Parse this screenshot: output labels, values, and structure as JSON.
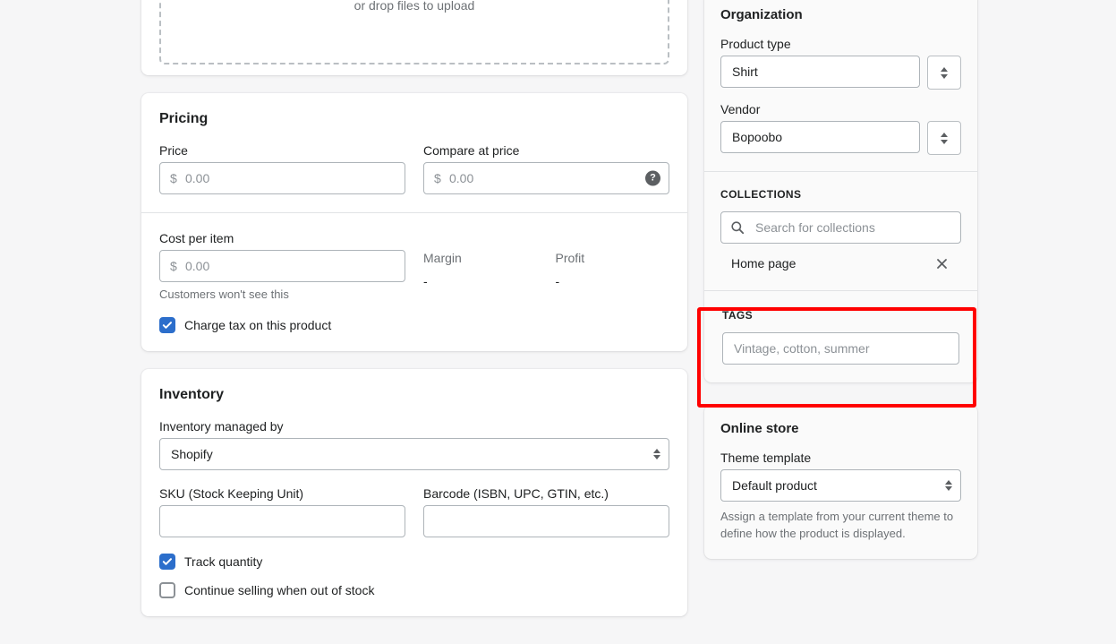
{
  "media": {
    "dropzone_text": "or drop files to upload"
  },
  "pricing": {
    "title": "Pricing",
    "price": {
      "label": "Price",
      "currency_symbol": "$",
      "value": "",
      "placeholder": "0.00"
    },
    "compare_at_price": {
      "label": "Compare at price",
      "currency_symbol": "$",
      "value": "",
      "placeholder": "0.00",
      "help_icon_glyph": "?"
    },
    "cost_per_item": {
      "label": "Cost per item",
      "currency_symbol": "$",
      "value": "",
      "placeholder": "0.00",
      "helper_text": "Customers won't see this"
    },
    "margin": {
      "label": "Margin",
      "value": "-"
    },
    "profit": {
      "label": "Profit",
      "value": "-"
    },
    "charge_tax": {
      "label": "Charge tax on this product",
      "checked": true
    }
  },
  "inventory": {
    "title": "Inventory",
    "managed_by": {
      "label": "Inventory managed by",
      "value": "Shopify"
    },
    "sku": {
      "label": "SKU (Stock Keeping Unit)",
      "value": "",
      "placeholder": ""
    },
    "barcode": {
      "label": "Barcode (ISBN, UPC, GTIN, etc.)",
      "value": "",
      "placeholder": ""
    },
    "track_quantity": {
      "label": "Track quantity",
      "checked": true
    },
    "continue_selling": {
      "label": "Continue selling when out of stock",
      "checked": false
    }
  },
  "organization": {
    "title": "Organization",
    "product_type": {
      "label": "Product type",
      "value": "Shirt"
    },
    "vendor": {
      "label": "Vendor",
      "value": "Bopoobo"
    },
    "collections": {
      "heading": "COLLECTIONS",
      "search_placeholder": "Search for collections",
      "search_value": "",
      "selected": [
        {
          "name": "Home page",
          "remove_glyph": "✕"
        }
      ]
    },
    "tags": {
      "heading": "TAGS",
      "value": "",
      "placeholder": "Vintage, cotton, summer"
    }
  },
  "online_store": {
    "title": "Online store",
    "theme_template": {
      "label": "Theme template",
      "value": "Default product",
      "helper_text": "Assign a template from your current theme to define how the product is displayed."
    }
  },
  "annotation": {
    "target": "tags-field",
    "color": "#ff0000"
  }
}
